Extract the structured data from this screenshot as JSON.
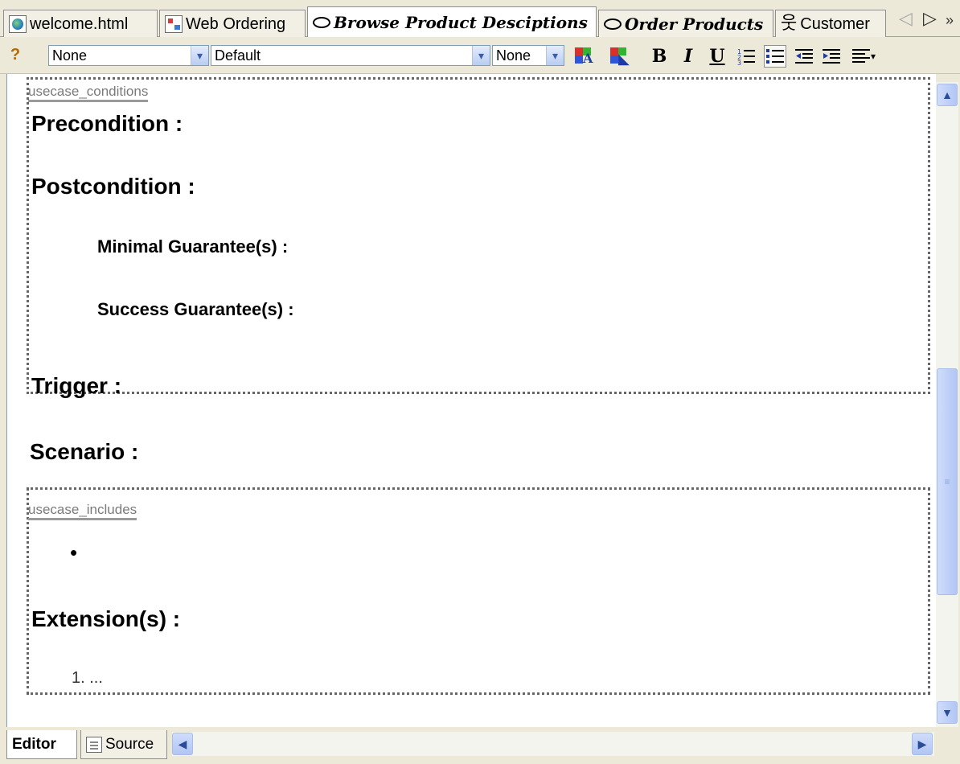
{
  "tabs": [
    {
      "label": "welcome.html",
      "icon": "html-page-icon",
      "style": "normal"
    },
    {
      "label": "Web Ordering",
      "icon": "diagram-icon",
      "style": "normal"
    },
    {
      "label": "Browse Product Desciptions",
      "icon": "usecase-oval-icon",
      "style": "bold-italic",
      "active": true
    },
    {
      "label": "Order Products",
      "icon": "usecase-oval-icon",
      "style": "bold-italic"
    },
    {
      "label": "Customer",
      "icon": "actor-icon",
      "style": "normal"
    }
  ],
  "tab_nav": {
    "left": "◁",
    "right": "▷",
    "more": "»"
  },
  "toolbar": {
    "style_select": "None",
    "font_select": "Default",
    "size_select": "None",
    "bold": "B",
    "italic": "I",
    "underline": "U",
    "dropdown_arrow": "▾"
  },
  "document": {
    "conditions_tag": "usecase_conditions",
    "precondition": "Precondition :",
    "postcondition": "Postcondition :",
    "minimal_guarantee": "Minimal Guarantee(s) :",
    "success_guarantee": "Success Guarantee(s) :",
    "trigger": "Trigger :",
    "scenario": "Scenario :",
    "includes_tag": "usecase_includes",
    "bullet": "•",
    "extensions": "Extension(s) :",
    "extension_item": "1. ..."
  },
  "bottom_tabs": [
    {
      "label": "Editor",
      "active": true
    },
    {
      "label": "Source",
      "active": false
    }
  ],
  "scroll_glyphs": {
    "up": "▲",
    "down": "▼",
    "left": "◀",
    "right": "▶",
    "grip": "≡"
  }
}
